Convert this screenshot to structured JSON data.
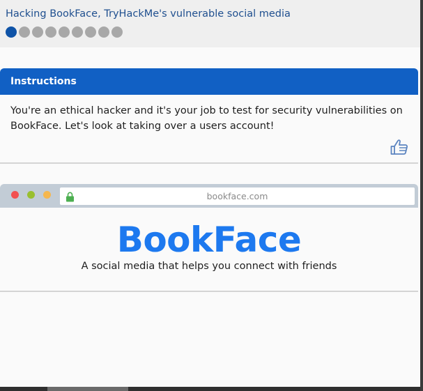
{
  "room": {
    "title": "Hacking BookFace, TryHackMe's vulnerable social media",
    "progress": {
      "current": 1,
      "total": 9
    }
  },
  "instructions": {
    "header": "Instructions",
    "body": "You're an ethical hacker and it's your job to test for security vulnerabilities on BookFace. Let's look at taking over a users account!",
    "confirm_icon": "thumbs-up-icon"
  },
  "browser": {
    "url": "bookface.com",
    "site_title": "BookFace",
    "tagline": "A social media that helps you connect with friends"
  },
  "colors": {
    "header_blue": "#1160c4",
    "logo_blue": "#1d79ef",
    "dot_active": "#0f53a7",
    "dot_inactive": "#a8a8a8"
  }
}
